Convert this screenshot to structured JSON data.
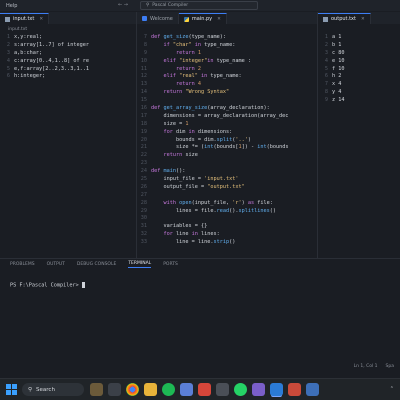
{
  "titlebar": {
    "menu_help": "Help",
    "search_text": "Pascal Compiler"
  },
  "left_pane": {
    "tab_label": "input.txt",
    "breadcrumb": "input.txt",
    "lines": [
      "x,y:real;",
      "s:array[1..7] of integer",
      "a,b:char;",
      "c:array[0..4,1..8] of re",
      "e,f:array[2..2,3..3,1..1",
      "h:integer;"
    ]
  },
  "middle_pane": {
    "tabs": [
      {
        "label": "Welcome"
      },
      {
        "label": "main.py"
      }
    ],
    "line_numbers": [
      "7",
      "8",
      "9",
      "10",
      "11",
      "12",
      "13",
      "14",
      "15",
      "16",
      "17",
      "18",
      "19",
      "20",
      "21",
      "22",
      "23",
      "24",
      "25",
      "26",
      "27",
      "28",
      "29",
      "30",
      "31",
      "32",
      "33"
    ]
  },
  "right_pane": {
    "tab_label": "output.txt",
    "lines": [
      {
        "n": "1",
        "text": "a 1"
      },
      {
        "n": "2",
        "text": "b 1"
      },
      {
        "n": "3",
        "text": "c 80"
      },
      {
        "n": "4",
        "text": "e 10"
      },
      {
        "n": "5",
        "text": "f 10"
      },
      {
        "n": "6",
        "text": "h 2"
      },
      {
        "n": "7",
        "text": "x 4"
      },
      {
        "n": "8",
        "text": "y 4"
      },
      {
        "n": "9",
        "text": "z 14"
      }
    ]
  },
  "panel": {
    "tabs": [
      "PROBLEMS",
      "OUTPUT",
      "DEBUG CONSOLE",
      "TERMINAL",
      "PORTS"
    ],
    "active_tab": "TERMINAL",
    "terminal_prompt": "PS F:\\Pascal Compiler>"
  },
  "statusbar": {
    "position": "Ln 1, Col 1",
    "spaces": "Spa"
  },
  "taskbar": {
    "search_label": "Search"
  },
  "colors": {
    "accent": "#3d7ef5",
    "keyword": "#c678dd",
    "function": "#61afef",
    "string": "#e5c07b"
  }
}
